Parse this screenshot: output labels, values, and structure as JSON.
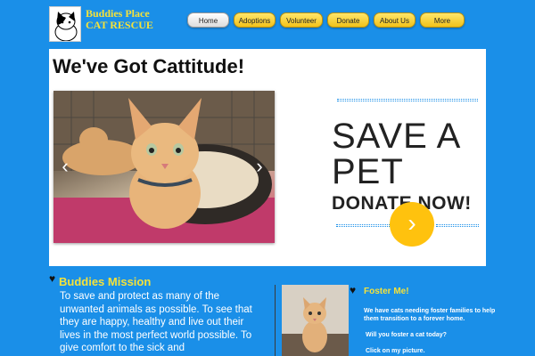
{
  "brand": {
    "title_line1": "Buddies Place",
    "title_line2": "CAT RESCUE"
  },
  "nav": {
    "items": [
      "Home",
      "Adoptions",
      "Volunteer",
      "Donate",
      "About Us",
      "More"
    ],
    "active": "Home"
  },
  "hero": {
    "title": "We've Got Cattitude!",
    "prev_glyph": "‹",
    "next_glyph": "›"
  },
  "promo": {
    "line1": "SAVE A",
    "line2": "PET",
    "line3": "DONATE NOW!",
    "button_glyph": "›",
    "button_color": "#ffc20e"
  },
  "mission": {
    "title": "Buddies Mission",
    "text": "To save and protect as many of the unwanted animals as possible. To see that they are happy, healthy and live out their lives in the most perfect world possible. To give comfort to the sick and"
  },
  "foster": {
    "title": "Foster Me!",
    "text": "We have cats needing foster families to help them transition to a forever home.",
    "question": "Will you foster a cat today?",
    "click": "Click on my picture."
  },
  "colors": {
    "background": "#1a8fe8",
    "accent_yellow": "#f5e23a"
  }
}
